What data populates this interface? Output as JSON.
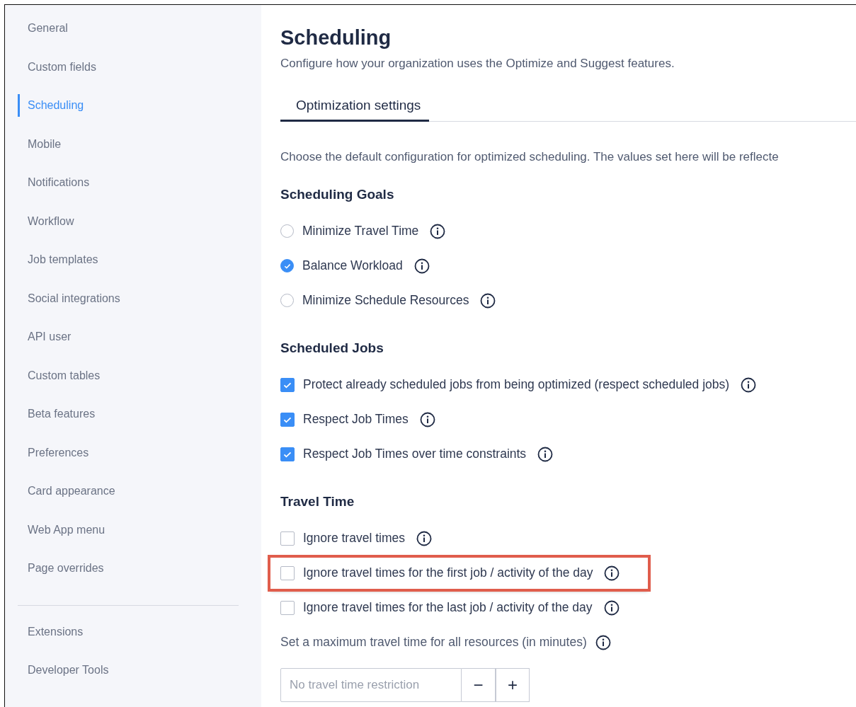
{
  "sidebar": {
    "items": [
      {
        "label": "General",
        "selected": false
      },
      {
        "label": "Custom fields",
        "selected": false
      },
      {
        "label": "Scheduling",
        "selected": true
      },
      {
        "label": "Mobile",
        "selected": false
      },
      {
        "label": "Notifications",
        "selected": false
      },
      {
        "label": "Workflow",
        "selected": false
      },
      {
        "label": "Job templates",
        "selected": false
      },
      {
        "label": "Social integrations",
        "selected": false
      },
      {
        "label": "API user",
        "selected": false
      },
      {
        "label": "Custom tables",
        "selected": false
      },
      {
        "label": "Beta features",
        "selected": false
      },
      {
        "label": "Preferences",
        "selected": false
      },
      {
        "label": "Card appearance",
        "selected": false
      },
      {
        "label": "Web App menu",
        "selected": false
      },
      {
        "label": "Page overrides",
        "selected": false
      }
    ],
    "footer_items": [
      {
        "label": "Extensions",
        "selected": false
      },
      {
        "label": "Developer Tools",
        "selected": false
      }
    ]
  },
  "page": {
    "title": "Scheduling",
    "subtitle": "Configure how your organization uses the Optimize and Suggest features."
  },
  "tabs": [
    {
      "label": "Optimization settings",
      "selected": true
    }
  ],
  "description": "Choose the default configuration for optimized scheduling. The values set here will be reflecte",
  "sections": [
    {
      "heading": "Scheduling Goals",
      "options": [
        {
          "kind": "radio",
          "label": "Minimize Travel Time",
          "checked": false,
          "highlighted": false
        },
        {
          "kind": "radio",
          "label": "Balance Workload",
          "checked": true,
          "highlighted": false
        },
        {
          "kind": "radio",
          "label": "Minimize Schedule Resources",
          "checked": false,
          "highlighted": false
        }
      ]
    },
    {
      "heading": "Scheduled Jobs",
      "options": [
        {
          "kind": "checkbox",
          "label": "Protect already scheduled jobs from being optimized (respect scheduled jobs)",
          "checked": true,
          "highlighted": false
        },
        {
          "kind": "checkbox",
          "label": "Respect Job Times",
          "checked": true,
          "highlighted": false
        },
        {
          "kind": "checkbox",
          "label": "Respect Job Times over time constraints",
          "checked": true,
          "highlighted": false
        }
      ]
    },
    {
      "heading": "Travel Time",
      "options": [
        {
          "kind": "checkbox",
          "label": "Ignore travel times",
          "checked": false,
          "highlighted": false
        },
        {
          "kind": "checkbox",
          "label": "Ignore travel times for the first job / activity of the day",
          "checked": false,
          "highlighted": true
        },
        {
          "kind": "checkbox",
          "label": "Ignore travel times for the last job / activity of the day",
          "checked": false,
          "highlighted": false
        }
      ]
    }
  ],
  "max_travel": {
    "label": "Set a maximum travel time for all resources (in minutes)",
    "placeholder": "No travel time restriction",
    "decrement": "−",
    "increment": "+"
  }
}
